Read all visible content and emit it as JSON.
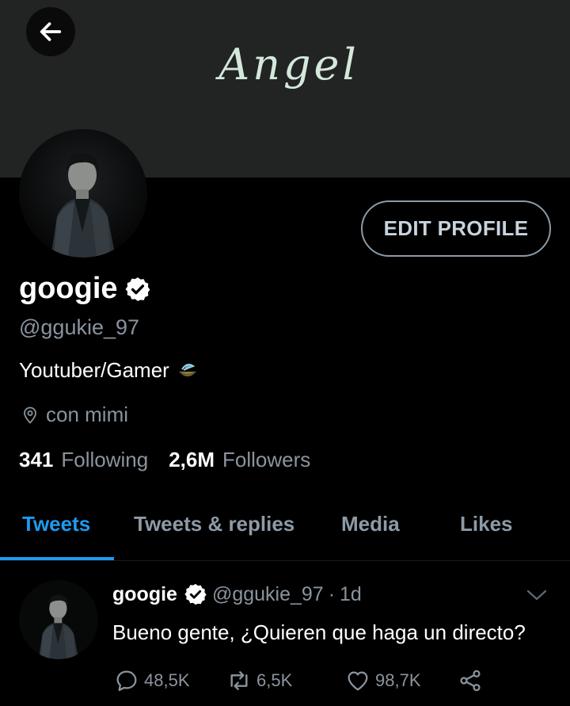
{
  "header": {
    "banner_title": "Angel",
    "back_icon": "arrow-left-icon"
  },
  "profile": {
    "edit_label": "EDIT PROFILE",
    "name": "googie",
    "handle": "@ggukie_97",
    "bio": "Youtuber/Gamer",
    "bio_emoji": "teacup-icon",
    "location": "con mimi",
    "following_count": "341",
    "following_label": "Following",
    "followers_count": "2,6M",
    "followers_label": "Followers"
  },
  "tabs": [
    {
      "label": "Tweets",
      "active": true
    },
    {
      "label": "Tweets & replies",
      "active": false
    },
    {
      "label": "Media",
      "active": false
    },
    {
      "label": "Likes",
      "active": false
    }
  ],
  "tweet": {
    "name": "googie",
    "handle": "@ggukie_97",
    "separator": "·",
    "time": "1d",
    "text": "Bueno gente, ¿Quieren que haga un directo?",
    "replies": "48,5K",
    "retweets": "6,5K",
    "likes": "98,7K"
  },
  "colors": {
    "accent": "#1d9bf0",
    "background": "#000000",
    "banner": "#222423",
    "secondary_text": "#8a949e"
  }
}
